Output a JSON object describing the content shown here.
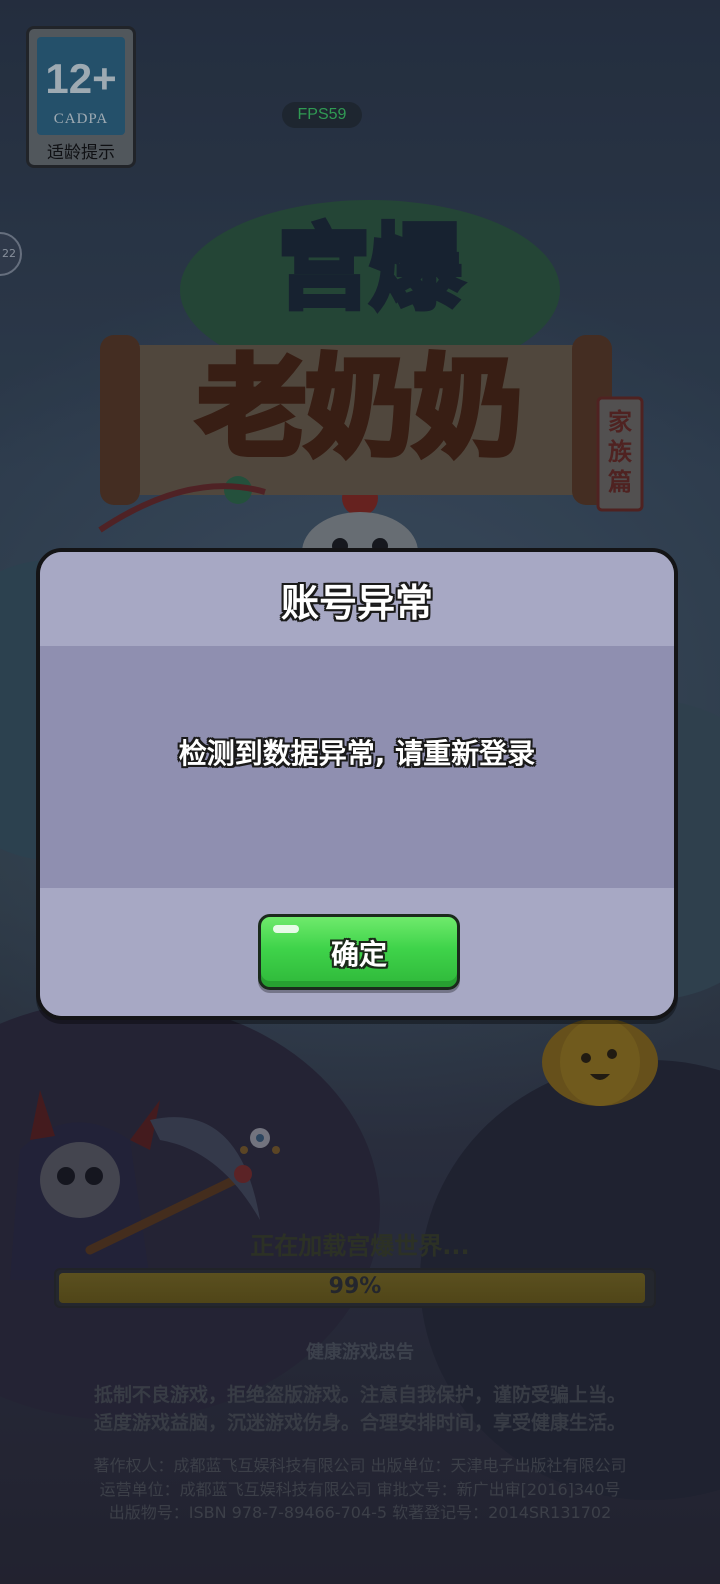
{
  "age_badge": {
    "rating": "12+",
    "org": "CADPA",
    "label": "适龄提示"
  },
  "fps": "FPS59",
  "side_badge": "22",
  "logo": {
    "line1": "宫爆",
    "line2": "老奶奶",
    "stamp": "家族篇"
  },
  "loading": {
    "text": "正在加载宫爆世界...",
    "percent_label": "99%",
    "progress": 0.99
  },
  "health_notice": {
    "title": "健康游戏忠告",
    "line1": "抵制不良游戏，拒绝盗版游戏。注意自我保护，谨防受骗上当。",
    "line2": "适度游戏益脑，沉迷游戏伤身。合理安排时间，享受健康生活。"
  },
  "credits": {
    "line1": "著作权人：成都蓝飞互娱科技有限公司  出版单位：天津电子出版社有限公司",
    "line2": "运营单位：成都蓝飞互娱科技有限公司  审批文号：新广出审[2016]340号",
    "line3": "出版物号：ISBN 978-7-89466-704-5  软著登记号：2014SR131702"
  },
  "dialog": {
    "title": "账号异常",
    "message": "检测到数据异常, 请重新登录",
    "confirm_label": "确定"
  },
  "colors": {
    "dialog_bg": "#a7a8c4",
    "dialog_body": "#8f8fb0",
    "confirm_green": "#3fd34a",
    "progress_fill": "#7a6a22",
    "fps_green": "#3fd06a"
  }
}
